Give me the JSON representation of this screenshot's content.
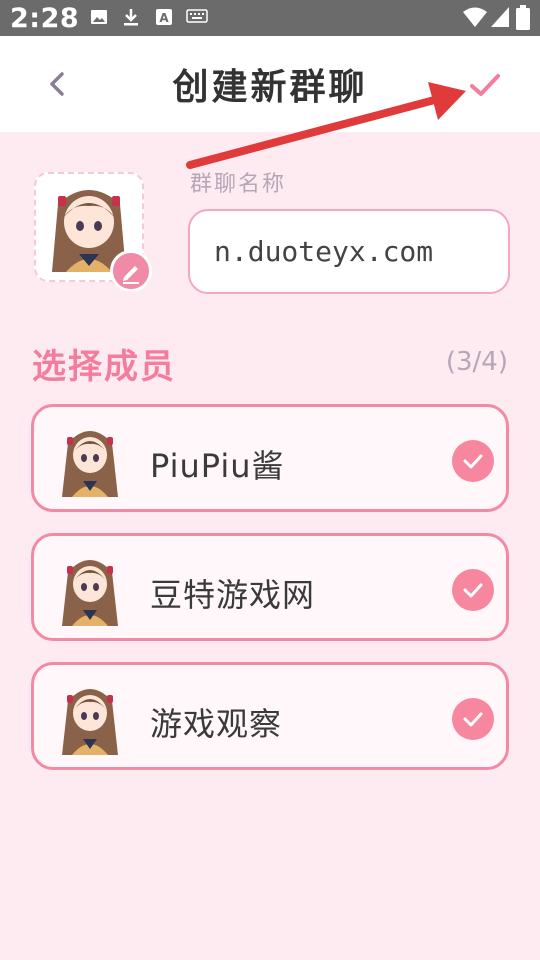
{
  "status_bar": {
    "time": "2:28",
    "icons": [
      "image-icon",
      "download-icon",
      "keyboard-a-icon",
      "keyboard-icon",
      "wifi-icon",
      "signal-icon",
      "battery-icon"
    ]
  },
  "header": {
    "title": "创建新群聊",
    "back_icon": "chevron-left-icon",
    "confirm_icon": "check-icon"
  },
  "group": {
    "avatar_icon": "edit-pencil-icon",
    "name_label": "群聊名称",
    "name_value": "n.duoteyx.com"
  },
  "members": {
    "section_title": "选择成员",
    "count": "(3/4)",
    "items": [
      {
        "name": "PiuPiu酱",
        "selected": true
      },
      {
        "name": "豆特游戏网",
        "selected": true
      },
      {
        "name": "游戏观察",
        "selected": true
      }
    ]
  },
  "colors": {
    "accent": "#f47c9d",
    "check": "#f6879f",
    "background": "#fdebf1",
    "annotation_arrow": "#e03a3a"
  }
}
